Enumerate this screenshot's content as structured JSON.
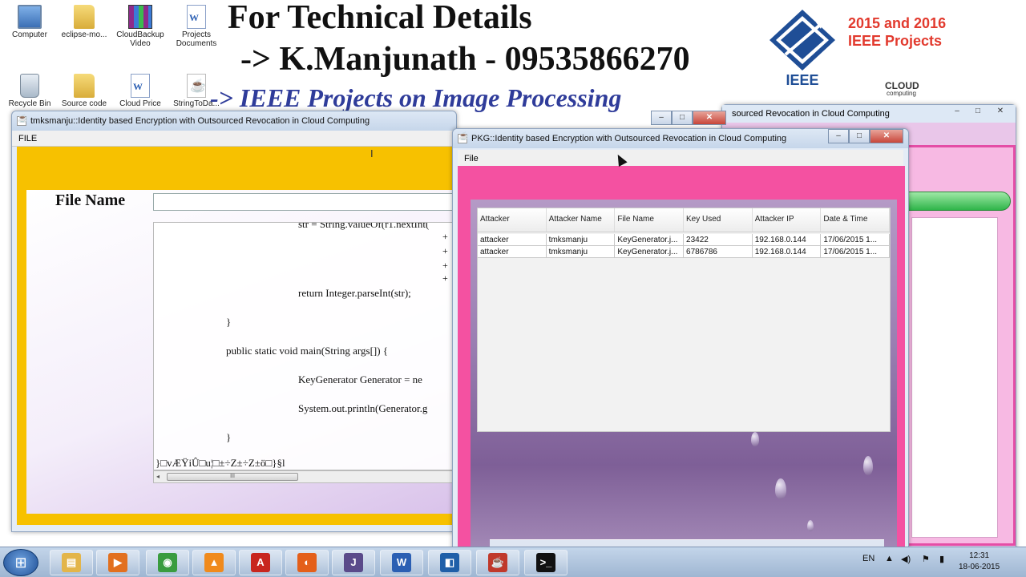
{
  "desktop": {
    "icons": [
      {
        "label": "Computer"
      },
      {
        "label": "eclipse-mo..."
      },
      {
        "label": "CloudBackup\nVideo"
      },
      {
        "label": "Projects\nDocuments"
      },
      {
        "label": "Recycle Bin"
      },
      {
        "label": "Source code"
      },
      {
        "label": "Cloud Price"
      },
      {
        "label": "StringToDa..."
      }
    ]
  },
  "banner": {
    "line1": "For Technical Details",
    "line2": "-> K.Manjunath - 09535866270",
    "line3": "-> IEEE Projects on Image Processing",
    "ieee_logo_text": "IEEE",
    "projects_line1": "2015 and 2016",
    "projects_line2": "IEEE Projects",
    "cloud_label": "CLOUD",
    "cloud_sub": "computing"
  },
  "back_window": {
    "title": "sourced Revocation in Cloud Computing"
  },
  "left_window": {
    "title": "tmksmanju::Identity based Encryption with Outsourced Revocation in Cloud Computing",
    "menu": "FILE",
    "file_name_label": "File Name",
    "file_name_value": "",
    "code_lines": [
      "str = String.valueOf(r1.nextInt(",
      "return Integer.parseInt(str);",
      "}",
      "public static void main(String args[]) {",
      "KeyGenerator Generator = ne",
      "System.out.println(Generator.g",
      "}",
      "}□vÆŸiÛ□u¦□±÷Z±÷Z±ö□}§l"
    ],
    "plus_glyph": "+",
    "scroll_thumb": "III"
  },
  "pkg_window": {
    "title": "PKG::Identity based Encryption with Outsourced Revocation in Cloud Computing",
    "menu": "File",
    "table": {
      "columns": [
        "Attacker",
        "Attacker Name",
        "File Name",
        "Key Used",
        "Attacker IP",
        "Date & Time"
      ],
      "rows": [
        [
          "attacker",
          "tmksmanju",
          "KeyGenerator.j...",
          "23422",
          "192.168.0.144",
          "17/06/2015   1..."
        ],
        [
          "attacker",
          "tmksmanju",
          "KeyGenerator.j...",
          "6786786",
          "192.168.0.144",
          "17/06/2015   1..."
        ]
      ]
    }
  },
  "window_controls": {
    "minimize": "–",
    "maximize": "□",
    "close": "✕"
  },
  "taskbar": {
    "start_glyph": "⊞",
    "apps": [
      {
        "name": "explorer",
        "glyph": "▤",
        "color": "#e3b54a"
      },
      {
        "name": "media-player",
        "glyph": "▶",
        "color": "#e2701f"
      },
      {
        "name": "chrome",
        "glyph": "◉",
        "color": "#3a9c3f"
      },
      {
        "name": "vlc",
        "glyph": "▲",
        "color": "#f08a1c"
      },
      {
        "name": "acrobat",
        "glyph": "A",
        "color": "#c8261e"
      },
      {
        "name": "firefox",
        "glyph": "◐",
        "color": "#e45f1a"
      },
      {
        "name": "java-ee-ide",
        "glyph": "J",
        "color": "#5a4a8a"
      },
      {
        "name": "word",
        "glyph": "W",
        "color": "#2b5fb3"
      },
      {
        "name": "remote-app",
        "glyph": "◧",
        "color": "#1f5fa8"
      },
      {
        "name": "java",
        "glyph": "☕",
        "color": "#c0392b"
      },
      {
        "name": "cmd",
        "glyph": ">_",
        "color": "#111111"
      }
    ],
    "language": "EN",
    "time": "12:31",
    "date": "18-06-2015"
  },
  "colors": {
    "left_body": "#f7c100",
    "pkg_body": "#f451a1",
    "banner_blue": "#2f3c9a",
    "ieee_red": "#e23a2e"
  }
}
